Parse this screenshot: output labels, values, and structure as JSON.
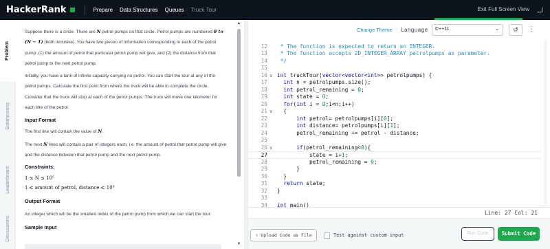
{
  "topbar": {
    "logo_text": "HackerRank",
    "breadcrumbs": [
      "Prepare",
      "Data Structures",
      "Queues",
      "Truck Tour"
    ],
    "exit_fullscreen": "Exit Full Screen View"
  },
  "sidebar": {
    "tabs": [
      "Problem",
      "Submissions",
      "Leaderboard",
      "Discussions"
    ]
  },
  "problem": {
    "intro1_pre": "Suppose there is a circle. There are ",
    "intro1_var": "N",
    "intro1_post": " petrol pumps on that circle. Petrol pumps are numbered ",
    "intro1_range": "0 to (N − 1)",
    "intro1_rest": " (both inclusive). You have two pieces of information corresponding to each of the petrol pump: (1) the amount of petrol that particular petrol pump will give, and (2) the distance from that petrol pump to the next petrol pump.",
    "intro2": "Initially, you have a tank of infinite capacity carrying no petrol. You can start the tour at any of the petrol pumps. Calculate the first point from where the truck will be able to complete the circle. Consider that the truck will stop at each of the petrol pumps. The truck will move one kilometer for each litre of the petrol.",
    "input_format_heading": "Input Format",
    "input1_pre": "The first line will contain the value of ",
    "input1_var": "N",
    "input1_post": ".",
    "input2_pre": "The next ",
    "input2_var": "N",
    "input2_post": " lines will contain a pair of integers each, i.e. the amount of petrol that petrol pump will give and the distance between that petrol pump and the next petrol pump.",
    "constraints_heading": "Constraints:",
    "constraint1": "1 ≤ N ≤ 10⁵",
    "constraint2": "1 ≤ amount of petrol, distance ≤ 10⁹",
    "output_format_heading": "Output Format",
    "output_text": "An integer which will be the smallest index of the petrol pump from which we can start the tour.",
    "sample_input_heading": "Sample Input"
  },
  "editor": {
    "change_theme": "Change Theme",
    "language_label": "Language",
    "language_value": "C++11",
    "cursor_status": "Line: 27  Col: 21",
    "current_line": 27
  },
  "code_lines": [
    {
      "n": "12",
      "fold": "",
      "text": " * The function is expected to return an INTEGER."
    },
    {
      "n": "13",
      "fold": "",
      "text": " * The function accepts 2D_INTEGER_ARRAY petrolpumps as parameter."
    },
    {
      "n": "14",
      "fold": "",
      "text": " */"
    },
    {
      "n": "15",
      "fold": "",
      "text": ""
    },
    {
      "n": "16",
      "fold": "∨",
      "text": "int truckTour(vector<vector<int>> petrolpumps) {"
    },
    {
      "n": "17",
      "fold": "",
      "text": "  int n = petrolpumps.size();"
    },
    {
      "n": "18",
      "fold": "",
      "text": "  int petrol_remaining = 0;"
    },
    {
      "n": "19",
      "fold": "",
      "text": "  int state = 0;"
    },
    {
      "n": "20",
      "fold": "",
      "text": "  for(int i = 0;i<n;i++)"
    },
    {
      "n": "21",
      "fold": "∨",
      "text": "  {"
    },
    {
      "n": "22",
      "fold": "",
      "text": "      int petrol= petrolpumps[i][0];"
    },
    {
      "n": "23",
      "fold": "",
      "text": "      int distance= petrolpumps[i][1];"
    },
    {
      "n": "24",
      "fold": "",
      "text": "      petrol_remaining += petrol - distance;"
    },
    {
      "n": "25",
      "fold": "",
      "text": ""
    },
    {
      "n": "26",
      "fold": "∨",
      "text": "      if(petrol_remaining<0){"
    },
    {
      "n": "27",
      "fold": "",
      "text": "          state = i+1;"
    },
    {
      "n": "28",
      "fold": "",
      "text": "          petrol_remaining = 0;"
    },
    {
      "n": "29",
      "fold": "",
      "text": "      }"
    },
    {
      "n": "30",
      "fold": "",
      "text": "  }"
    },
    {
      "n": "31",
      "fold": "",
      "text": "  return state;"
    },
    {
      "n": "32",
      "fold": "",
      "text": "}"
    },
    {
      "n": "33",
      "fold": "",
      "text": ""
    },
    {
      "n": "34",
      "fold": "",
      "text": "int main()"
    }
  ],
  "footer": {
    "upload_label": "Upload Code as File",
    "custom_input_label": "Test against custom input",
    "run_label": "Run Code",
    "submit_label": "Submit Code"
  },
  "colors": {
    "topbar": "#0e141e",
    "accent_green": "#1ba94c",
    "link_blue": "#1f8ecd",
    "comment": "#1f8ecd",
    "keyword": "#0000c9",
    "number": "#0a8a4a"
  },
  "icons": {
    "fullscreen": "expand-icon",
    "history": "history-icon",
    "more": "kebab-menu-icon",
    "upload": "upload-icon",
    "dropdown": "chevron-down-icon"
  }
}
